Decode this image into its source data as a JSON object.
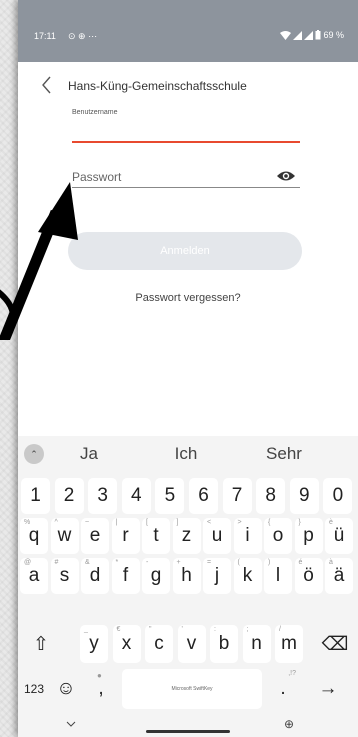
{
  "statusbar": {
    "time": "17:11",
    "left_icons": "⊙ ⊕ ⋯",
    "battery": "69 %"
  },
  "appbar": {
    "title": "Hans-Küng-Gemeinschaftsschule"
  },
  "login": {
    "username_label": "Benutzername",
    "password_placeholder": "Passwort",
    "login_button": "Anmelden",
    "forgot_password": "Passwort vergessen?"
  },
  "keyboard": {
    "suggestions": [
      "Ja",
      "Ich",
      "Sehr"
    ],
    "numbers": [
      "1",
      "2",
      "3",
      "4",
      "5",
      "6",
      "7",
      "8",
      "9",
      "0"
    ],
    "row1": [
      {
        "k": "q",
        "h": "%"
      },
      {
        "k": "w",
        "h": "^"
      },
      {
        "k": "e",
        "h": "~"
      },
      {
        "k": "r",
        "h": "|"
      },
      {
        "k": "t",
        "h": "["
      },
      {
        "k": "z",
        "h": "]"
      },
      {
        "k": "u",
        "h": "<"
      },
      {
        "k": "i",
        "h": ">"
      },
      {
        "k": "o",
        "h": "{"
      },
      {
        "k": "p",
        "h": "}"
      },
      {
        "k": "ü",
        "h": "è"
      }
    ],
    "row2": [
      {
        "k": "a",
        "h": "@"
      },
      {
        "k": "s",
        "h": "#"
      },
      {
        "k": "d",
        "h": "&"
      },
      {
        "k": "f",
        "h": "*"
      },
      {
        "k": "g",
        "h": "-"
      },
      {
        "k": "h",
        "h": "+"
      },
      {
        "k": "j",
        "h": "="
      },
      {
        "k": "k",
        "h": "("
      },
      {
        "k": "l",
        "h": ")"
      },
      {
        "k": "ö",
        "h": "é"
      },
      {
        "k": "ä",
        "h": "à"
      }
    ],
    "row3": [
      {
        "k": "y",
        "h": "_"
      },
      {
        "k": "x",
        "h": "€"
      },
      {
        "k": "c",
        "h": "\""
      },
      {
        "k": "v",
        "h": "'"
      },
      {
        "k": "b",
        "h": ":"
      },
      {
        "k": "n",
        "h": ";"
      },
      {
        "k": "m",
        "h": "/"
      }
    ],
    "shift": "⇧",
    "backspace": "⌫",
    "num_key": "123",
    "emoji": "☺",
    "comma": ",",
    "space_label": "Microsoft SwiftKey",
    "period": ".",
    "period_hint": ",!?",
    "enter": "→",
    "globe": "⊕"
  }
}
